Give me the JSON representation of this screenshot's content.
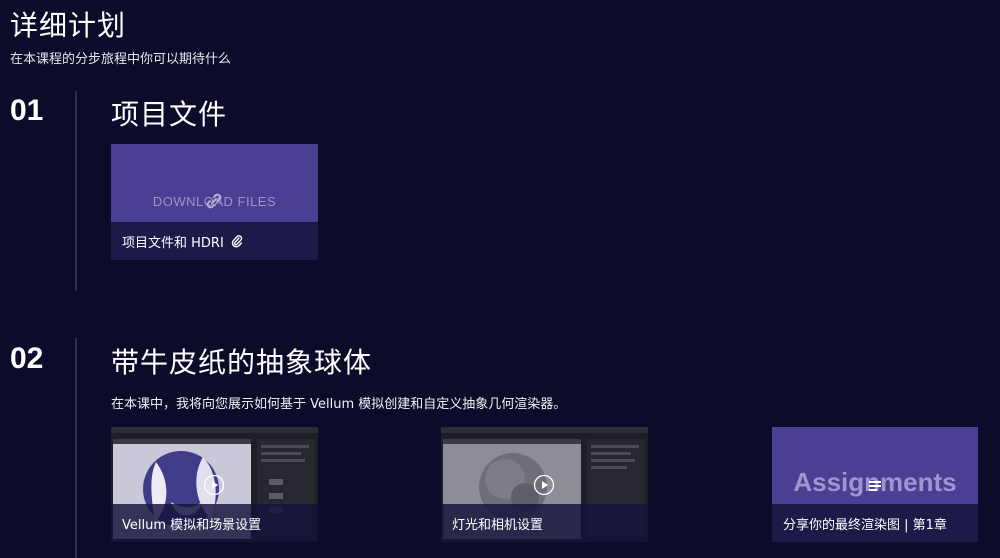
{
  "header": {
    "title": "详细计划",
    "subtitle": "在本课程的分步旅程中你可以期待什么"
  },
  "sections": [
    {
      "number": "01",
      "title": "项目文件",
      "cards": [
        {
          "overlay_text": "DOWNLOAD FILES",
          "caption": "项目文件和 HDRI",
          "icon": "paperclip-icon",
          "overlay_icon": "link-icon"
        }
      ]
    },
    {
      "number": "02",
      "title": "带牛皮纸的抽象球体",
      "description": "在本课中，我将向您展示如何基于 Vellum 模拟创建和自定义抽象几何渲染器。",
      "cards": [
        {
          "caption": "Vellum 模拟和场景设置",
          "overlay_icon": "play-icon"
        },
        {
          "caption": "灯光和相机设置",
          "overlay_icon": "play-icon"
        },
        {
          "overlay_text": "Assignments",
          "caption": "分享你的最终渲染图 | 第1章",
          "overlay_icon": "list-icon"
        }
      ]
    }
  ],
  "colors": {
    "background": "#0c0b2a",
    "card_purple": "#4a3f93",
    "divider": "#2f2e55"
  }
}
